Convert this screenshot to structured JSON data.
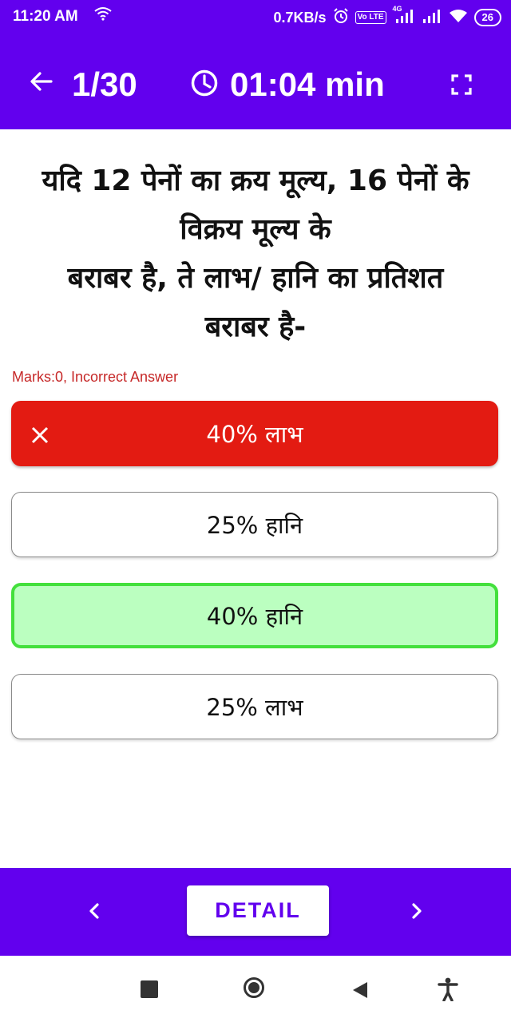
{
  "status": {
    "time": "11:20 AM",
    "speed": "0.7KB/s",
    "volte": "Vo LTE",
    "network": "4G",
    "battery": "26",
    "icons": [
      "wifi-icon",
      "alarm-icon",
      "volte-icon",
      "signal-icon",
      "signal-icon",
      "wifi-icon",
      "battery-icon"
    ]
  },
  "header": {
    "counter": "1/30",
    "timer": "01:04 min",
    "icons": [
      "back-arrow-icon",
      "clock-icon",
      "fullscreen-icon"
    ]
  },
  "question": {
    "lines": [
      "यदि 12 पेनों का क्रय मूल्य, 16 पेनों के",
      "विक्रय मूल्य के",
      "बराबर है, ते लाभ/ हानि का प्रतिशत",
      "बराबर है-"
    ]
  },
  "result": {
    "marks_text": "Marks:0, Incorrect Answer"
  },
  "options": [
    {
      "label": "40% लाभ",
      "state": "wrong",
      "icon": "close-icon"
    },
    {
      "label": "25% हानि",
      "state": "plain"
    },
    {
      "label": "40% हानि",
      "state": "correct"
    },
    {
      "label": "25% लाभ",
      "state": "plain"
    }
  ],
  "footer": {
    "detail_label": "DETAIL",
    "icons": [
      "chevron-left-icon",
      "chevron-right-icon"
    ]
  },
  "system_nav": {
    "icons": [
      "recents-icon",
      "home-icon",
      "back-icon",
      "accessibility-icon"
    ]
  },
  "colors": {
    "primary": "#6200ee",
    "wrong": "#e31b12",
    "correct_fill": "#bbffc0",
    "correct_border": "#43e03c",
    "marks_text": "#c62828"
  }
}
